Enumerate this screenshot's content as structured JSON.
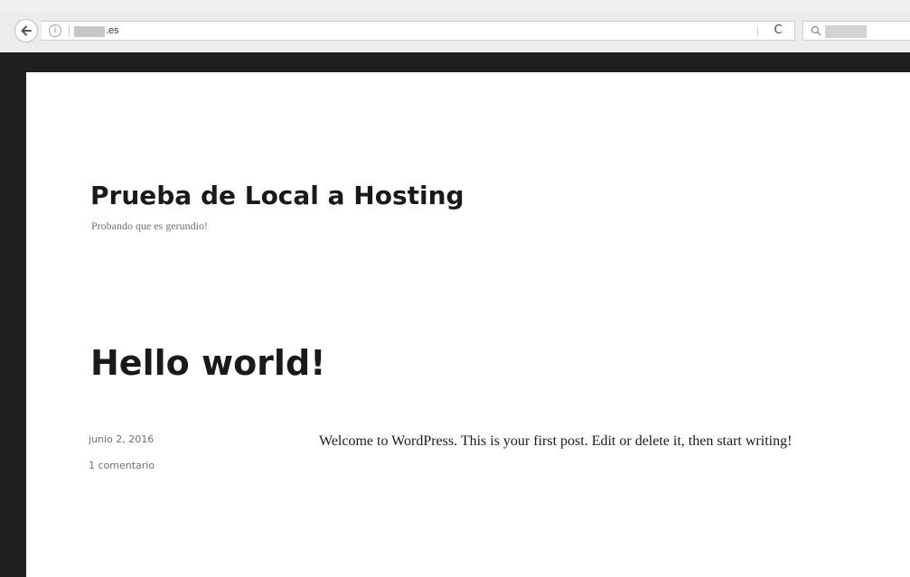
{
  "browser": {
    "url_text": ".es",
    "info_icon": "info-icon",
    "back_icon": "back-arrow-icon",
    "reload_icon": "reload-icon",
    "reload_glyph": "C",
    "info_glyph": "i",
    "search_icon": "search-icon"
  },
  "site": {
    "title": "Prueba de Local a Hosting",
    "tagline": "Probando que es gerundio!"
  },
  "post": {
    "title": "Hello world!",
    "date": "junio 2, 2016",
    "comments": "1 comentario",
    "body": "Welcome to WordPress. This is your first post. Edit or delete it, then start writing!"
  },
  "colors": {
    "frame": "#1f1f1f",
    "text_dark": "#1a1a1a",
    "text_muted": "#707070",
    "chrome_bg": "#ececec"
  }
}
